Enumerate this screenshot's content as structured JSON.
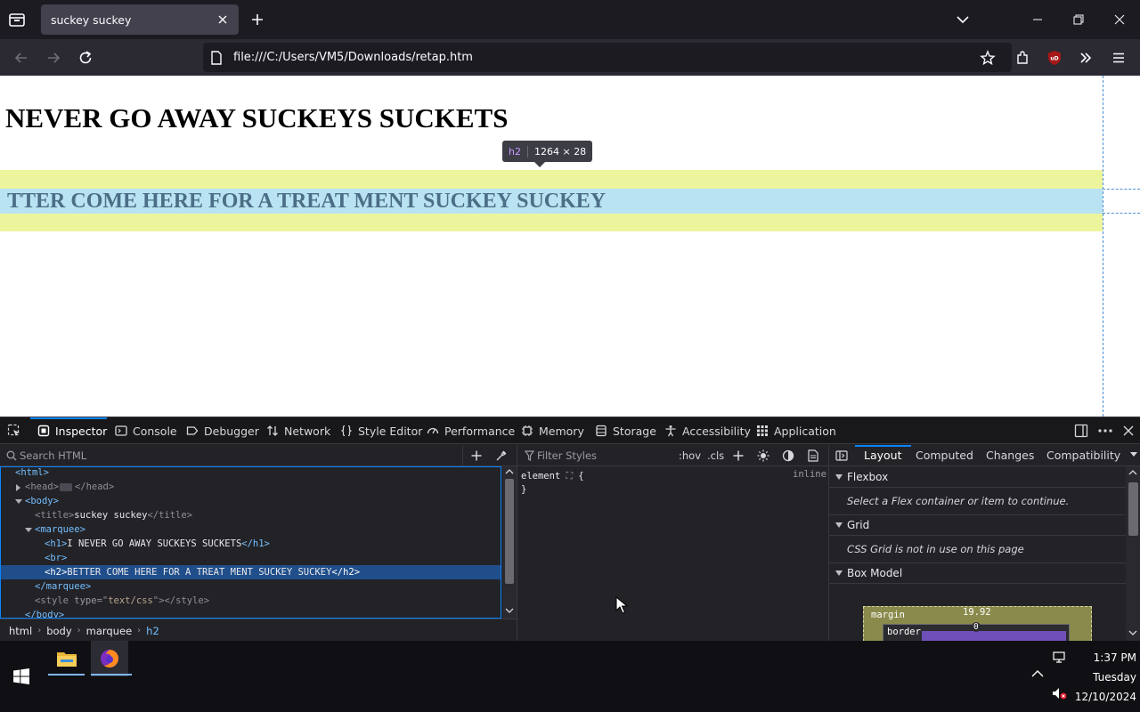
{
  "browser": {
    "tab_title": "suckey suckey",
    "url": "file:///C:/Users/VM5/Downloads/retap.htm"
  },
  "page": {
    "h1_text": "NEVER GO AWAY SUCKEYS SUCKETS",
    "h2_text": "TTER COME HERE FOR A TREAT MENT SUCKEY SUCKEY",
    "highlight_tag": "h2",
    "highlight_size": "1264 × 28"
  },
  "devtools": {
    "tabs": [
      {
        "label": "Inspector",
        "icon": "inspector-icon"
      },
      {
        "label": "Console",
        "icon": "console-icon"
      },
      {
        "label": "Debugger",
        "icon": "debugger-icon"
      },
      {
        "label": "Network",
        "icon": "network-icon"
      },
      {
        "label": "Style Editor",
        "icon": "style-editor-icon"
      },
      {
        "label": "Performance",
        "icon": "performance-icon"
      },
      {
        "label": "Memory",
        "icon": "memory-icon"
      },
      {
        "label": "Storage",
        "icon": "storage-icon"
      },
      {
        "label": "Accessibility",
        "icon": "accessibility-icon"
      },
      {
        "label": "Application",
        "icon": "application-icon"
      }
    ],
    "search_html_placeholder": "Search HTML",
    "tree": {
      "r0": "<html>",
      "r1a": "<head>",
      "r1b": "</head>",
      "r2": "<body>",
      "r3a": "<title>",
      "r3b": "suckey suckey",
      "r3c": "</title>",
      "r4": "<marquee>",
      "r5a": "<h1>",
      "r5b": "I NEVER GO AWAY SUCKEYS SUCKETS",
      "r5c": "</h1>",
      "r6": "<br>",
      "r7a": "<h2>",
      "r7b": "BETTER COME HERE FOR A TREAT MENT SUCKEY SUCKEY",
      "r7c": "</h2>",
      "r8": "</marquee>",
      "r9a": "<style ",
      "r9b": "type",
      "r9c": "=\"",
      "r9d": "text/css",
      "r9e": "\"></style>",
      "r10": "</body>"
    },
    "breadcrumbs": [
      "html",
      "body",
      "marquee",
      "h2"
    ],
    "rules": {
      "filter_placeholder": "Filter Styles",
      "hov": ":hov",
      "cls": ".cls",
      "line1": "element",
      "brace_open": "{",
      "brace_close": "}",
      "inline_label": "inline"
    },
    "layout": {
      "tabs": [
        "Layout",
        "Computed",
        "Changes",
        "Compatibility"
      ],
      "flexbox_title": "Flexbox",
      "flexbox_msg": "Select a Flex container or item to continue.",
      "grid_title": "Grid",
      "grid_msg": "CSS Grid is not in use on this page",
      "boxmodel_title": "Box Model",
      "margin_label": "margin",
      "margin_top": "19.92",
      "border_label": "border",
      "border_top": "0"
    }
  },
  "taskbar": {
    "time": "1:37 PM",
    "day": "Tuesday",
    "date": "12/10/2024"
  }
}
